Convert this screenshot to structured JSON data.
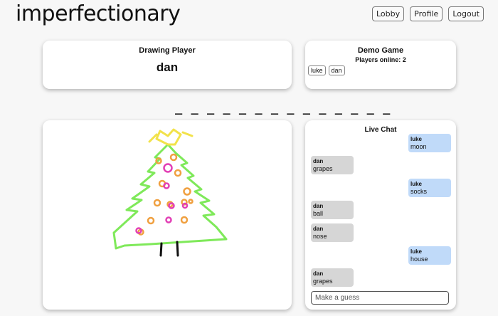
{
  "app": {
    "logo": "imperfectionary"
  },
  "nav": {
    "lobby": "Lobby",
    "profile": "Profile",
    "logout": "Logout"
  },
  "drawing": {
    "title": "Drawing Player",
    "player": "dan"
  },
  "game": {
    "title": "Demo Game",
    "online": "Players online: 2",
    "players": [
      "luke",
      "dan"
    ]
  },
  "word": {
    "mask": "_ _ _ _ _ _ _ _ _ _ _ _ _ _"
  },
  "chat": {
    "title": "Live Chat",
    "messages": [
      {
        "user": "luke",
        "text": "moon"
      },
      {
        "user": "dan",
        "text": "grapes"
      },
      {
        "user": "luke",
        "text": "socks"
      },
      {
        "user": "dan",
        "text": "ball"
      },
      {
        "user": "dan",
        "text": "nose"
      },
      {
        "user": "luke",
        "text": "house"
      },
      {
        "user": "dan",
        "text": "grapes"
      }
    ],
    "placeholder": "Make a guess"
  },
  "colors": {
    "tree": "#7fe95a",
    "star": "#f2e24a",
    "ornament_orange": "#f0a040",
    "ornament_pink": "#e23fb5",
    "trunk": "#111111",
    "chat_self": "#c0daf9",
    "chat_other": "#d6d6d6"
  }
}
